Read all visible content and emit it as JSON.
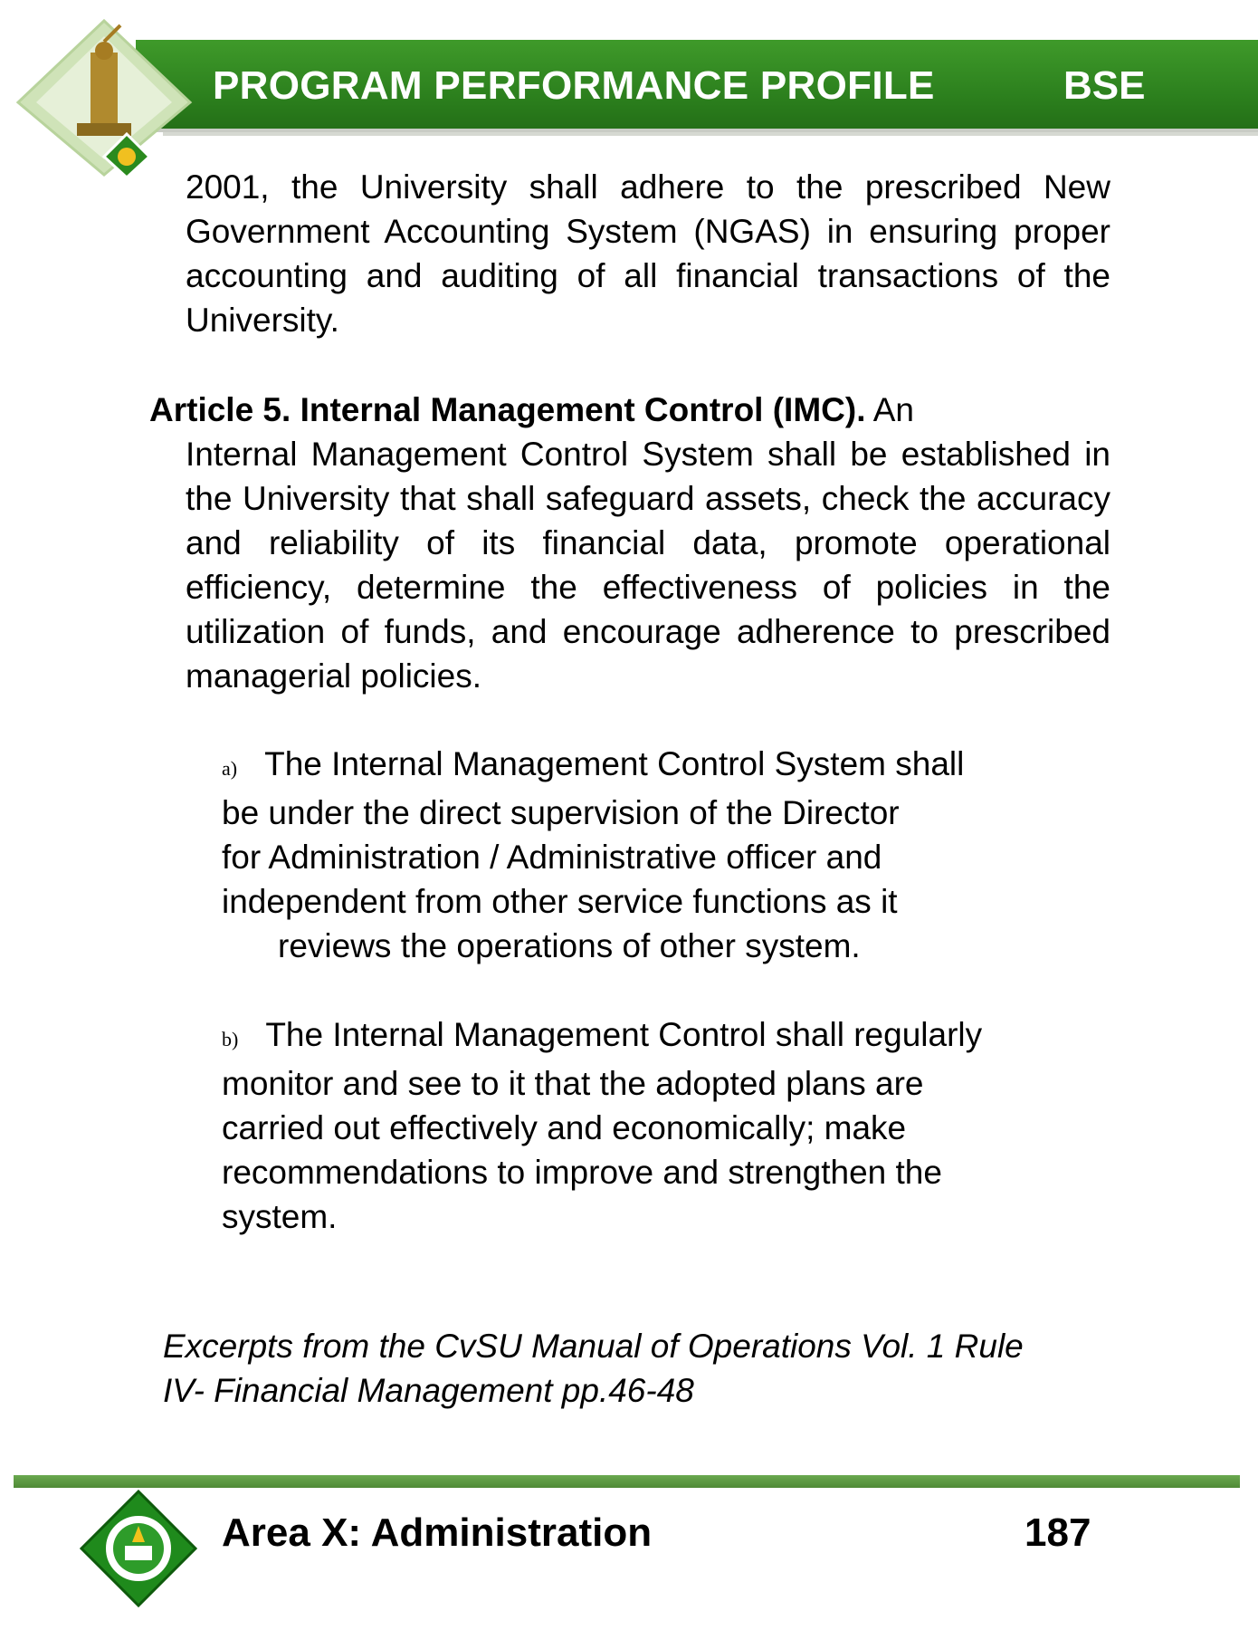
{
  "header": {
    "title": "PROGRAM PERFORMANCE PROFILE",
    "program_code": "BSE"
  },
  "body": {
    "paragraph_1": "2001, the University shall adhere to the prescribed New Government Accounting System (NGAS) in ensuring proper accounting and auditing of all financial transactions of the University.",
    "article": {
      "title": "Article 5. Internal Management Control (IMC).",
      "lead": "An",
      "text": "Internal Management Control System shall be established in the University that shall safeguard assets, check the accuracy and reliability of its financial data, promote operational efficiency, determine the effectiveness of policies in the utilization of funds, and encourage adherence to prescribed managerial policies."
    },
    "items": [
      {
        "marker": "a)",
        "line1": "The Internal Management Control System shall",
        "line2": "be under the direct supervision of the Director",
        "line3": "for Administration / Administrative officer and",
        "line4": "independent from other service functions as it",
        "line5": "reviews the operations of other system."
      },
      {
        "marker": "b)",
        "line1": "The Internal Management Control shall regularly",
        "line2": "monitor and see to it that the adopted plans are",
        "line3": "carried out effectively and economically; make",
        "line4": "recommendations to improve and strengthen the",
        "line5": "system."
      }
    ],
    "excerpt_line1": "Excerpts from the CvSU Manual of Operations Vol. 1 Rule",
    "excerpt_line2": "IV- Financial Management pp.46-48"
  },
  "footer": {
    "area": "Area X: Administration",
    "page_number": "187"
  },
  "colors": {
    "header_green": "#2a7d1c",
    "footer_rule_green": "#5c9a40"
  }
}
